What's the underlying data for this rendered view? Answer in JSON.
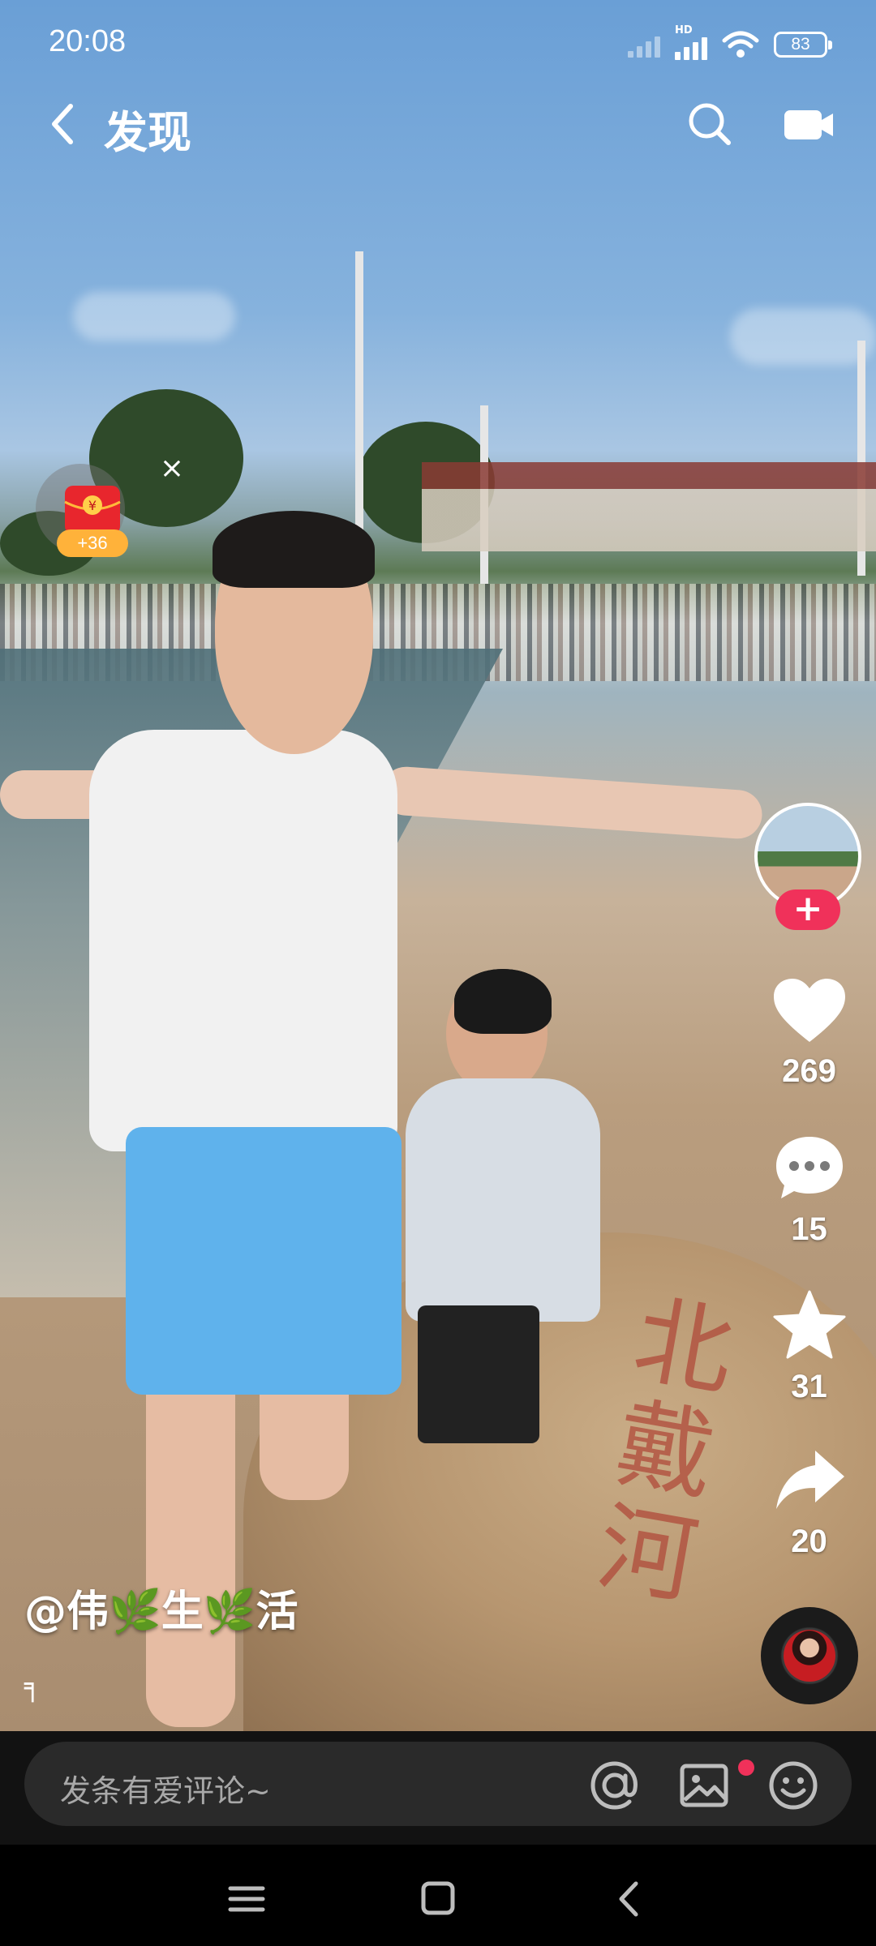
{
  "status_bar": {
    "time": "20:08",
    "network_label": "HD",
    "battery": "83"
  },
  "header": {
    "title": "发现",
    "back_icon": "chevron-left-icon",
    "search_icon": "search-icon",
    "camera_icon": "camera-icon"
  },
  "red_packet": {
    "bonus": "+36",
    "symbol": "¥",
    "close": "×"
  },
  "video": {
    "rock_inscription": "北戴河"
  },
  "actions": {
    "follow_label": "+",
    "like_count": "269",
    "comment_count": "15",
    "favorite_count": "31",
    "share_count": "20"
  },
  "author": {
    "name": "@伟🌿生🌿活",
    "desc": "╕"
  },
  "comment_bar": {
    "placeholder": "发条有爱评论~",
    "icons": [
      "at-icon",
      "image-icon",
      "emoji-icon"
    ]
  },
  "colors": {
    "accent": "#f0315a",
    "comment_bg": "#2a2a2a"
  }
}
